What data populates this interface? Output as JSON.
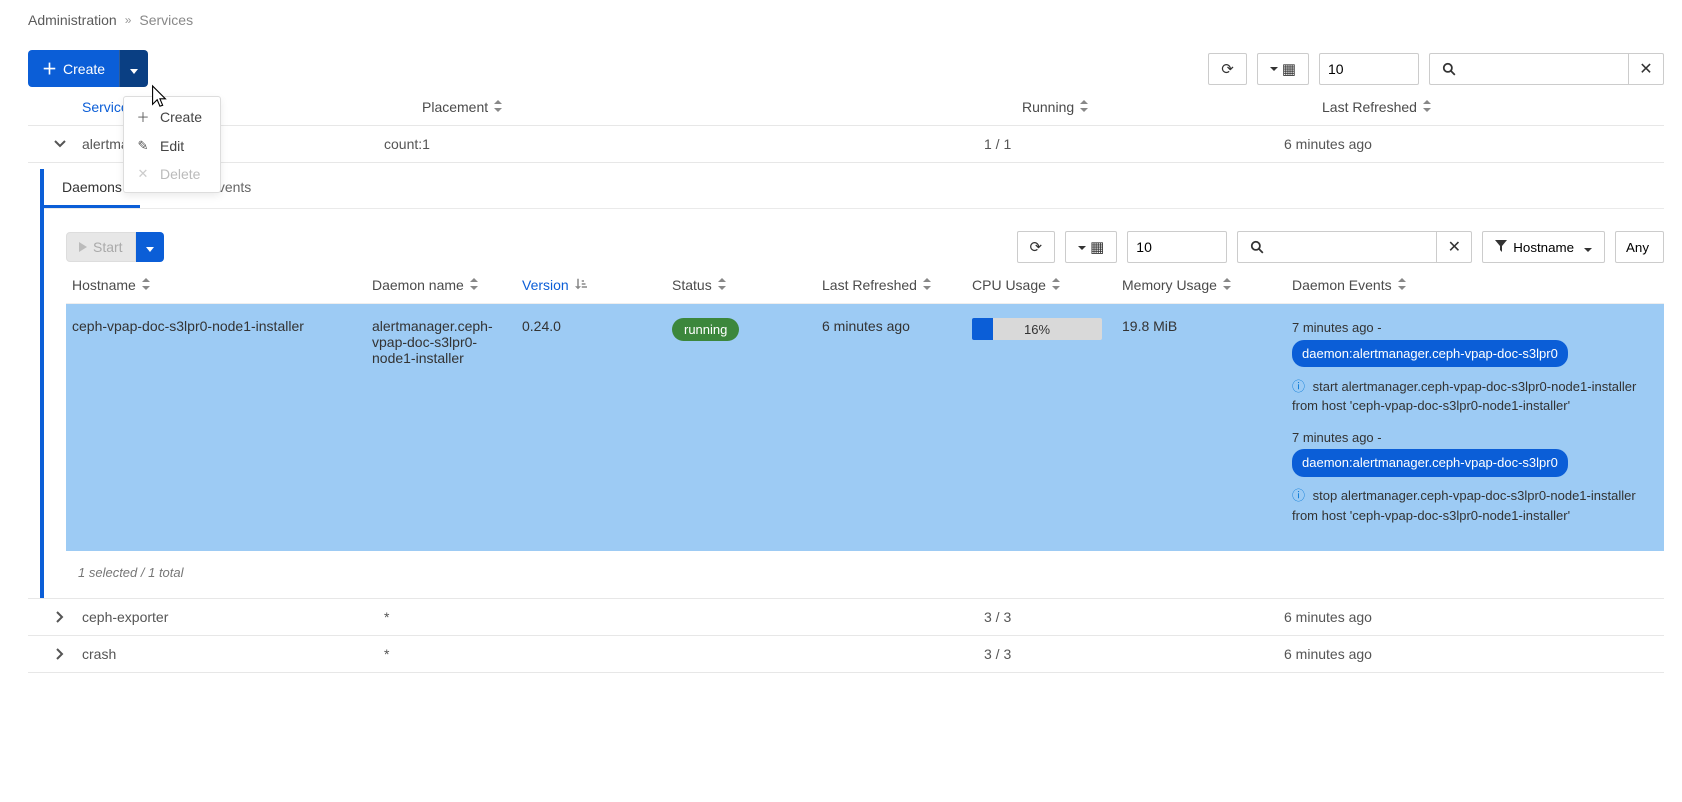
{
  "breadcrumb": {
    "admin": "Administration",
    "current": "Services"
  },
  "create_btn": {
    "label": "Create"
  },
  "dropdown": {
    "create": "Create",
    "edit": "Edit",
    "delete": "Delete"
  },
  "top_toolbar": {
    "page_size": "10"
  },
  "services_header": {
    "service": "Service",
    "placement": "Placement",
    "running": "Running",
    "refreshed": "Last Refreshed"
  },
  "services": [
    {
      "name": "alertman",
      "placement": "count:1",
      "running": "1 / 1",
      "refreshed": "6 minutes ago",
      "expanded": true
    },
    {
      "name": "ceph-exporter",
      "placement": "*",
      "running": "3 / 3",
      "refreshed": "6 minutes ago",
      "expanded": false
    },
    {
      "name": "crash",
      "placement": "*",
      "running": "3 / 3",
      "refreshed": "6 minutes ago",
      "expanded": false
    }
  ],
  "tabs": {
    "daemons": "Daemons",
    "events": "Service Events"
  },
  "daemons_toolbar": {
    "start": "Start",
    "page_size": "10",
    "hostname": "Hostname",
    "any": "Any"
  },
  "daemons_header": {
    "hostname": "Hostname",
    "daemon_name": "Daemon name",
    "version": "Version",
    "status": "Status",
    "refreshed": "Last Refreshed",
    "cpu": "CPU Usage",
    "mem": "Memory Usage",
    "events": "Daemon Events"
  },
  "daemon_row": {
    "hostname": "ceph-vpap-doc-s3lpr0-node1-installer",
    "daemon_name": "alertmanager.ceph-vpap-doc-s3lpr0-node1-installer",
    "version": "0.24.0",
    "status": "running",
    "refreshed": "6 minutes ago",
    "cpu_pct": "16%",
    "mem": "19.8 MiB",
    "events": [
      {
        "time": "7 minutes ago -",
        "chip": "daemon:alertmanager.ceph-vpap-doc-s3lpr0",
        "desc": "start alertmanager.ceph-vpap-doc-s3lpr0-node1-installer from host 'ceph-vpap-doc-s3lpr0-node1-installer'"
      },
      {
        "time": "7 minutes ago -",
        "chip": "daemon:alertmanager.ceph-vpap-doc-s3lpr0",
        "desc": "stop alertmanager.ceph-vpap-doc-s3lpr0-node1-installer from host 'ceph-vpap-doc-s3lpr0-node1-installer'"
      }
    ]
  },
  "selection_summary": "1 selected / 1 total"
}
